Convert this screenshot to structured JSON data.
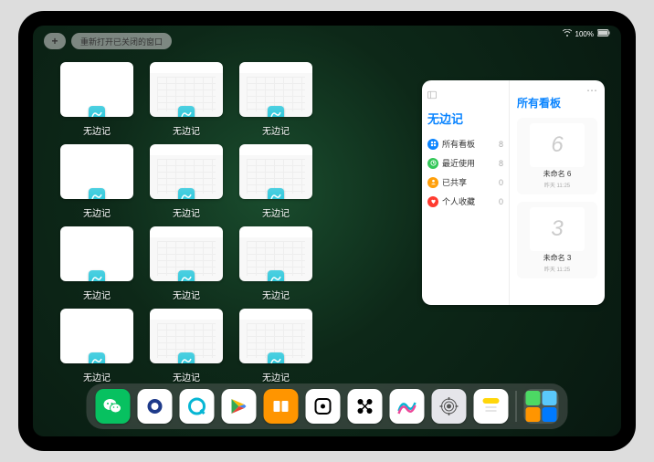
{
  "status": {
    "wifi": "wifi-icon",
    "battery_text": "100%"
  },
  "top_controls": {
    "add_label": "+",
    "reopen_label": "重新打开已关闭的窗口"
  },
  "app_switcher": {
    "tile_label": "无边记",
    "tiles": [
      {
        "type": "blank"
      },
      {
        "type": "calendar"
      },
      {
        "type": "calendar"
      },
      {
        "type": "blank"
      },
      {
        "type": "calendar"
      },
      {
        "type": "calendar"
      },
      {
        "type": "blank"
      },
      {
        "type": "calendar"
      },
      {
        "type": "calendar"
      },
      {
        "type": "blank"
      },
      {
        "type": "calendar"
      },
      {
        "type": "calendar"
      }
    ],
    "grid_rows": 4,
    "grid_cols": 4,
    "positions": [
      0,
      1,
      2,
      4,
      5,
      6,
      8,
      9,
      10,
      12,
      13,
      14
    ]
  },
  "panel": {
    "left_title": "无边记",
    "items": [
      {
        "label": "所有看板",
        "count": 8,
        "color": "#0a84ff",
        "icon": "grid"
      },
      {
        "label": "最近使用",
        "count": 8,
        "color": "#34c759",
        "icon": "clock"
      },
      {
        "label": "已共享",
        "count": 0,
        "color": "#ff9f0a",
        "icon": "person"
      },
      {
        "label": "个人收藏",
        "count": 0,
        "color": "#ff3b30",
        "icon": "heart"
      }
    ],
    "right_title": "所有看板",
    "boards": [
      {
        "name": "未命名 6",
        "date": "昨天 11:25",
        "doodle": "6"
      },
      {
        "name": "未命名 3",
        "date": "昨天 11:25",
        "doodle": "3"
      }
    ]
  },
  "dock": {
    "apps": [
      {
        "name": "wechat",
        "bg": "#07c160"
      },
      {
        "name": "browser-q",
        "bg": "#ffffff"
      },
      {
        "name": "qq-browser",
        "bg": "#ffffff"
      },
      {
        "name": "play",
        "bg": "#ffffff"
      },
      {
        "name": "books",
        "bg": "#ff9500"
      },
      {
        "name": "dice",
        "bg": "#ffffff"
      },
      {
        "name": "connect",
        "bg": "#ffffff"
      },
      {
        "name": "freeform",
        "bg": "#ffffff"
      },
      {
        "name": "settings",
        "bg": "#e5e5ea"
      },
      {
        "name": "notes",
        "bg": "#ffffff"
      }
    ],
    "recent": {
      "minis": [
        "#4cd964",
        "#5ac8fa",
        "#ff9500",
        "#007aff"
      ]
    }
  },
  "colors": {
    "accent": "#0a84ff"
  }
}
